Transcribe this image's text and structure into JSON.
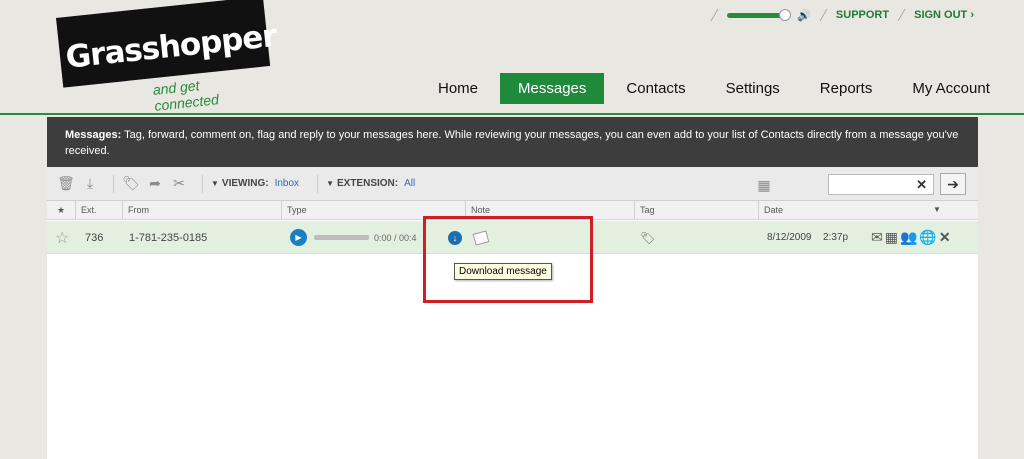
{
  "logo": {
    "name": "Grasshopper",
    "tagline": "and get connected"
  },
  "topbar": {
    "support": "SUPPORT",
    "signout": "SIGN OUT ›"
  },
  "nav": {
    "home": "Home",
    "messages": "Messages",
    "contacts": "Contacts",
    "settings": "Settings",
    "reports": "Reports",
    "account": "My Account"
  },
  "info": {
    "title": "Messages:",
    "text": " Tag, forward, comment on, flag and reply to your messages here. While reviewing your messages, you can even add to your list of Contacts directly from a message you've received."
  },
  "toolbar": {
    "viewing_label": "VIEWING:",
    "viewing_value": "Inbox",
    "extension_label": "EXTENSION:",
    "extension_value": "All",
    "search_placeholder": ""
  },
  "columns": {
    "ext": "Ext.",
    "from": "From",
    "type": "Type",
    "note": "Note",
    "tag": "Tag",
    "date": "Date"
  },
  "message": {
    "ext": "736",
    "from": "1-781-235-0185",
    "time_display": "0:00 / 00:4",
    "date": "8/12/2009",
    "time": "2:37p"
  },
  "tooltip": {
    "text": "Download message"
  },
  "colors": {
    "accent": "#1f8a3c",
    "highlight": "#d01f24"
  }
}
